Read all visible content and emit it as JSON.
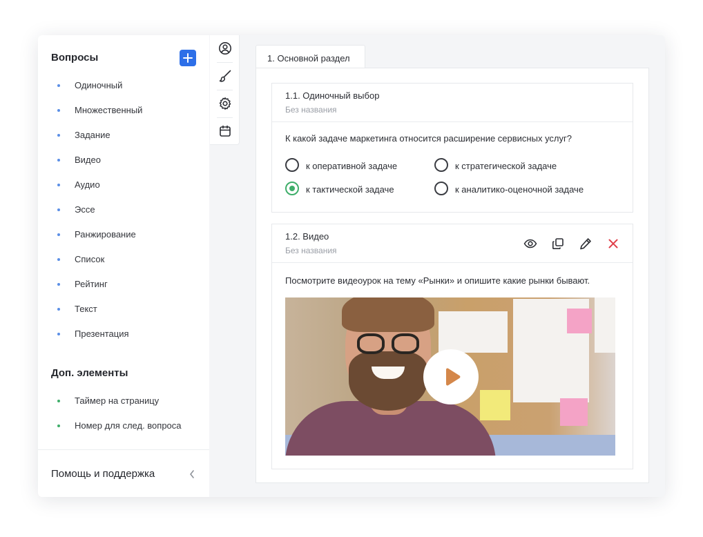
{
  "sidebar": {
    "questions_title": "Вопросы",
    "add_icon": "plus-icon",
    "question_types": [
      "Одиночный",
      "Множественный",
      "Задание",
      "Видео",
      "Аудио",
      "Эссе",
      "Ранжирование",
      "Список",
      "Рейтинг",
      "Текст",
      "Презентация"
    ],
    "extra_title": "Доп. элементы",
    "extra_items": [
      "Таймер на страницу",
      "Номер для след. вопроса"
    ],
    "footer_label": "Помощь и поддержка",
    "colors": {
      "accent": "#2d6fe8",
      "question_dot": "#5b8fe6",
      "extra_dot": "#3fae6a"
    }
  },
  "toolbar": {
    "icons": [
      "user-circle-icon",
      "brush-icon",
      "gear-icon",
      "calendar-icon"
    ]
  },
  "main": {
    "tab_label": "1. Основной раздел",
    "cards": [
      {
        "title": "1.1. Одиночный выбор",
        "subtitle": "Без названия",
        "question": "К какой задаче маркетинга относится расширение сервисных услуг?",
        "options": [
          {
            "label": "к оперативной задаче",
            "checked": false
          },
          {
            "label": "к стратегической задаче",
            "checked": false
          },
          {
            "label": "к тактической задаче",
            "checked": true
          },
          {
            "label": "к аналитико-оценочной задаче",
            "checked": false
          }
        ]
      },
      {
        "title": "1.2. Видео",
        "subtitle": "Без названия",
        "actions": [
          "eye-icon",
          "copy-icon",
          "pencil-icon",
          "close-icon"
        ],
        "text": "Посмотрите видеоурок на тему «Рынки» и опишите какие рынки бывают.",
        "video_icon": "play-icon"
      }
    ],
    "colors": {
      "checked": "#3fae6a",
      "delete": "#e0404a"
    }
  }
}
